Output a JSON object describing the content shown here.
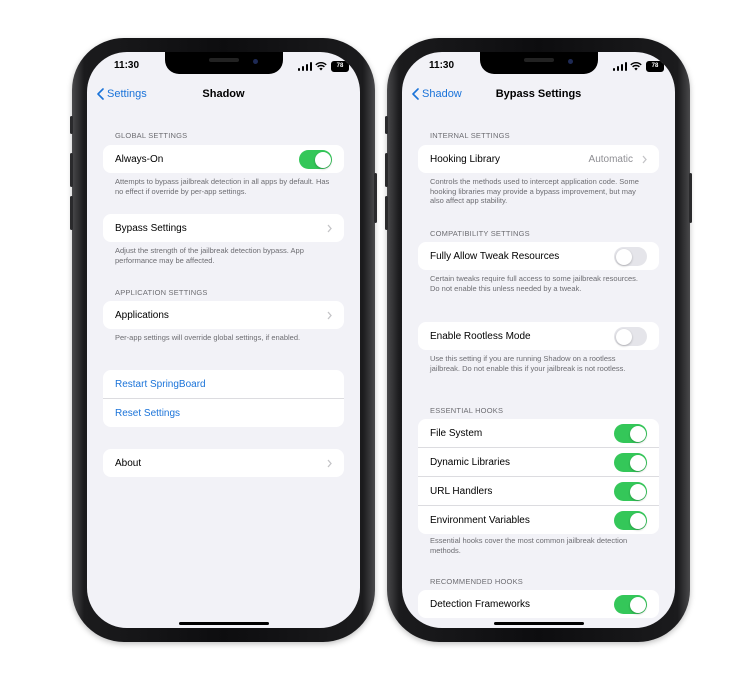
{
  "status_bar": {
    "time": "11:30",
    "battery": "78"
  },
  "left": {
    "nav": {
      "back": "Settings",
      "title": "Shadow"
    },
    "global_header": "GLOBAL SETTINGS",
    "always_on": {
      "label": "Always-On",
      "on": true
    },
    "always_on_footer": "Attempts to bypass jailbreak detection in all apps by default. Has no effect if override by per-app settings.",
    "bypass_settings": "Bypass Settings",
    "bypass_footer": "Adjust the strength of the jailbreak detection bypass. App performance may be affected.",
    "app_header": "APPLICATION SETTINGS",
    "applications": "Applications",
    "applications_footer": "Per-app settings will override global settings, if enabled.",
    "restart": "Restart SpringBoard",
    "reset": "Reset Settings",
    "about": "About"
  },
  "right": {
    "nav": {
      "back": "Shadow",
      "title": "Bypass Settings"
    },
    "internal_header": "INTERNAL SETTINGS",
    "hooking": {
      "label": "Hooking Library",
      "value": "Automatic"
    },
    "hooking_footer": "Controls the methods used to intercept application code. Some hooking libraries may provide a bypass improvement, but may also affect app stability.",
    "compat_header": "COMPATIBILITY SETTINGS",
    "tweak_resources": {
      "label": "Fully Allow Tweak Resources",
      "on": false
    },
    "tweak_footer": "Certain tweaks require full access to some jailbreak resources. Do not enable this unless needed by a tweak.",
    "rootless": {
      "label": "Enable Rootless Mode",
      "on": false
    },
    "rootless_footer": "Use this setting if you are running Shadow on a rootless jailbreak. Do not enable this if your jailbreak is not rootless.",
    "essential_header": "ESSENTIAL HOOKS",
    "essential": [
      {
        "label": "File System",
        "on": true
      },
      {
        "label": "Dynamic Libraries",
        "on": true
      },
      {
        "label": "URL Handlers",
        "on": true
      },
      {
        "label": "Environment Variables",
        "on": true
      }
    ],
    "essential_footer": "Essential hooks cover the most common jailbreak detection methods.",
    "recommended_header": "RECOMMENDED HOOKS",
    "detection": {
      "label": "Detection Frameworks",
      "on": true
    }
  },
  "colors": {
    "accent": "#1a73d9",
    "toggle_on": "#34c759",
    "background": "#f2f2f7"
  },
  "icons": [
    "chevron-left-icon",
    "chevron-right-icon",
    "signal-icon",
    "wifi-icon",
    "battery-icon"
  ]
}
